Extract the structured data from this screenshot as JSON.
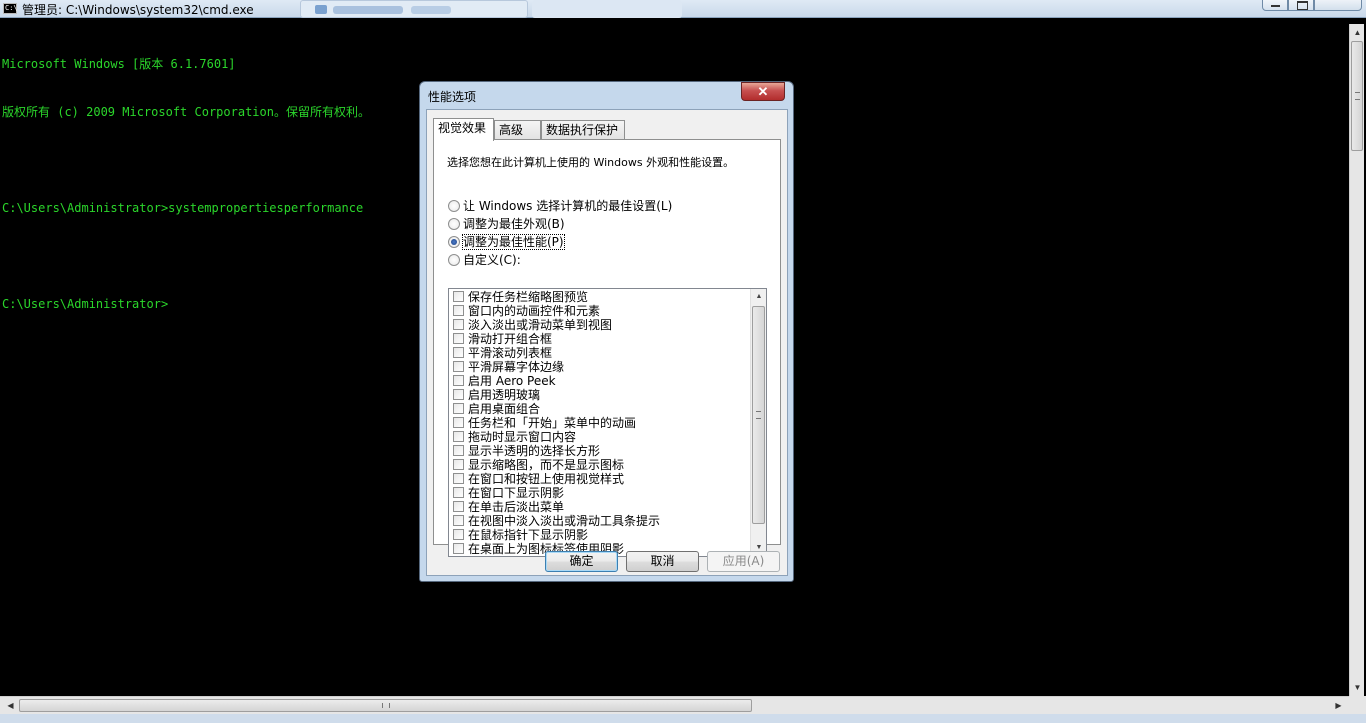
{
  "window": {
    "title": "管理员: C:\\Windows\\system32\\cmd.exe"
  },
  "console": {
    "lines": [
      "Microsoft Windows [版本 6.1.7601]",
      "版权所有 (c) 2009 Microsoft Corporation。保留所有权利。",
      "",
      "C:\\Users\\Administrator>systempropertiesperformance",
      "",
      "C:\\Users\\Administrator>"
    ]
  },
  "dialog": {
    "title": "性能选项",
    "close_glyph": "✕",
    "tabs": [
      "视觉效果",
      "高级",
      "数据执行保护"
    ],
    "active_tab": 0,
    "description": "选择您想在此计算机上使用的 Windows 外观和性能设置。",
    "radios": [
      {
        "label": "让 Windows 选择计算机的最佳设置(L)",
        "checked": false
      },
      {
        "label": "调整为最佳外观(B)",
        "checked": false
      },
      {
        "label": "调整为最佳性能(P)",
        "checked": true
      },
      {
        "label": "自定义(C):",
        "checked": false
      }
    ],
    "effects": [
      "保存任务栏缩略图预览",
      "窗口内的动画控件和元素",
      "淡入淡出或滑动菜单到视图",
      "滑动打开组合框",
      "平滑滚动列表框",
      "平滑屏幕字体边缘",
      "启用 Aero Peek",
      "启用透明玻璃",
      "启用桌面组合",
      "任务栏和「开始」菜单中的动画",
      "拖动时显示窗口内容",
      "显示半透明的选择长方形",
      "显示缩略图，而不是显示图标",
      "在窗口和按钮上使用视觉样式",
      "在窗口下显示阴影",
      "在单击后淡出菜单",
      "在视图中淡入淡出或滑动工具条提示",
      "在鼠标指针下显示阴影",
      "在桌面上为图标标签使用阴影"
    ],
    "buttons": {
      "ok": "确定",
      "cancel": "取消",
      "apply": "应用(A)"
    }
  },
  "colors": {
    "console_text": "#2bd62b",
    "console_bg": "#000000"
  }
}
